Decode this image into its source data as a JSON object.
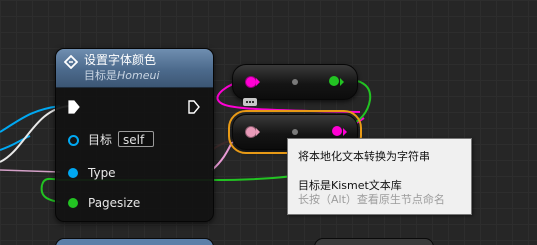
{
  "node": {
    "title": "设置字体颜色",
    "subtitle_prefix": "目标是",
    "subtitle_target": "Homeui",
    "icon": "function-icon",
    "pins": {
      "target_label": "目标",
      "target_value": "self",
      "type_label": "Type",
      "pagesize_label": "Pagesize"
    }
  },
  "tooltip": {
    "line1": "将本地化文本转换为字符串",
    "line2": "目标是Kismet文本库",
    "line3": "长按（Alt）查看原生节点命名"
  },
  "colors": {
    "exec": "#ffffff",
    "object_pin": "#00a8f2",
    "type_pin": "#00a8f2",
    "pagesize_pin": "#22c322",
    "text_pin": "#f06bbf",
    "string_pin": "#ff00d4",
    "bool_pin": "#22c322",
    "selection": "#e89a16",
    "header": "#4c6a8c"
  }
}
